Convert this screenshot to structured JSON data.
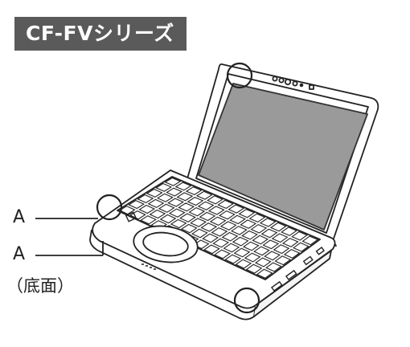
{
  "header": {
    "series_title": "CF-FVシリーズ",
    "badge_color": "#5a5a5a"
  },
  "callouts": {
    "top_label": "A",
    "bottom_label": "A",
    "bottom_note": "（底面）"
  },
  "illustration": {
    "subject": "laptop-computer",
    "highlight_circles": 3
  }
}
